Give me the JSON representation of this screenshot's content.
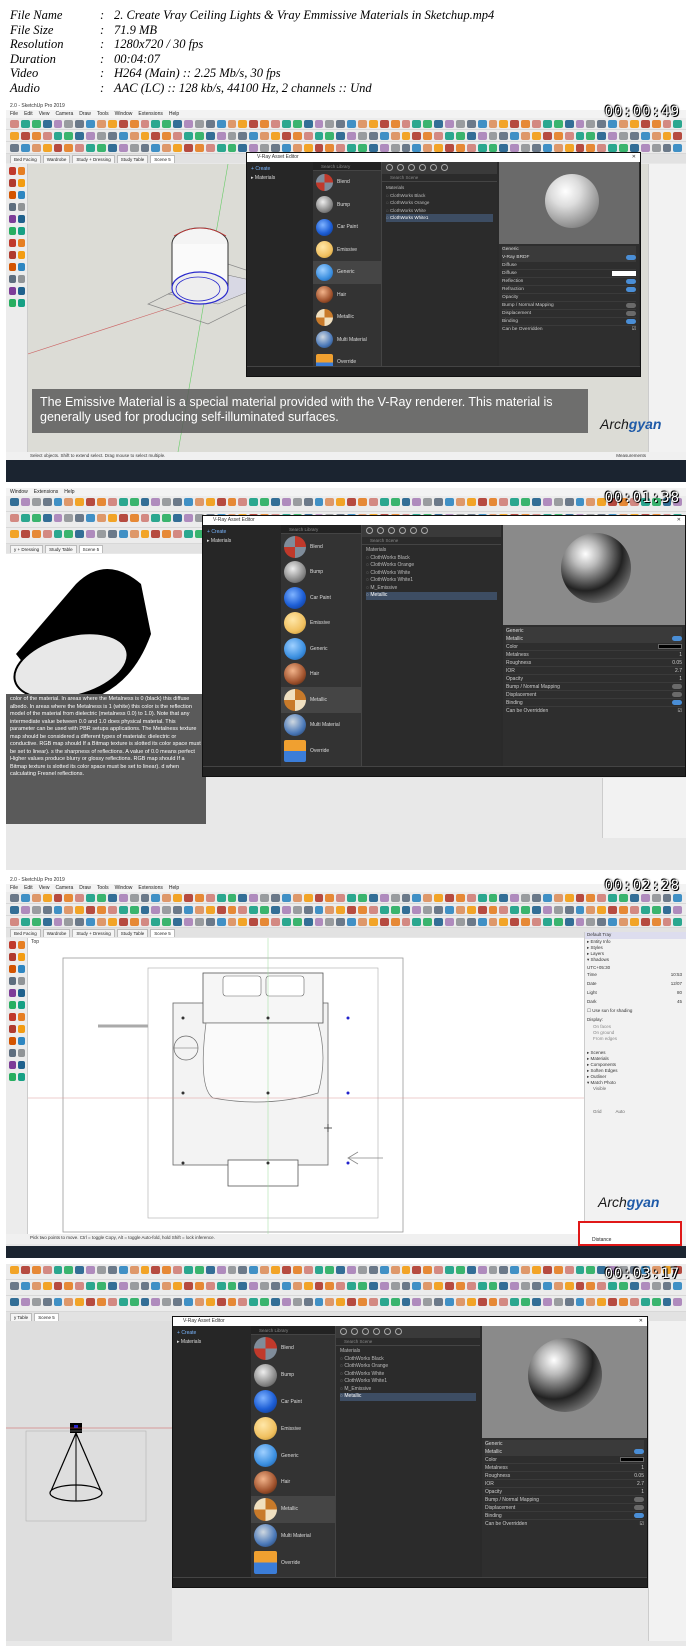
{
  "header": {
    "rows": [
      {
        "key": "File Name",
        "value": "2. Create Vray Ceiling Lights & Vray Emmissive Materials in Sketchup.mp4"
      },
      {
        "key": "File Size",
        "value": "71.9 MB"
      },
      {
        "key": "Resolution",
        "value": "1280x720 / 30 fps"
      },
      {
        "key": "Duration",
        "value": "00:04:07"
      },
      {
        "key": "Video",
        "value": "H264 (Main) :: 2.25 Mb/s, 30 fps"
      },
      {
        "key": "Audio",
        "value": "AAC (LC) :: 128 kb/s, 44100 Hz, 2 channels :: Und"
      }
    ]
  },
  "frames": [
    {
      "timestamp": "00:00:49"
    },
    {
      "timestamp": "00:01:38"
    },
    {
      "timestamp": "00:02:28"
    },
    {
      "timestamp": "00:03:17"
    }
  ],
  "app": {
    "title": "2.0 - SketchUp Pro 2019",
    "menu": [
      "File",
      "Edit",
      "View",
      "Camera",
      "Draw",
      "Tools",
      "Window",
      "Extensions",
      "Help"
    ],
    "scenes": [
      "Bed Facing",
      "Wardrobe",
      "Study + Dressing",
      "Study Table",
      "Scene 5"
    ],
    "status_frame1": "Select objects. Shift to extend select. Drag mouse to select multiple.",
    "status_frame3": "Pick two points to move.  Ctrl = toggle Copy, Alt = toggle Auto-fold, hold Shift = lock inference.",
    "measurements_label": "Measurements",
    "distance_label": "Distance",
    "top_label": "Top"
  },
  "editor": {
    "title": "V-Ray Asset Editor",
    "tree": [
      "Create",
      "Materials"
    ],
    "search_library": "Search Library",
    "search_scene": "Search Scene",
    "library": [
      "Blend",
      "Bump",
      "Car Paint",
      "Emissive",
      "Generic",
      "Hair",
      "Metallic",
      "Multi Material",
      "Override"
    ],
    "scene_header": "Materials",
    "scene_list_a": [
      "ClothWorks Black",
      "ClothWorks Orange",
      "ClothWorks White",
      "ClothWorks White1"
    ],
    "scene_list_b": [
      "ClothWorks Black",
      "ClothWorks Orange",
      "ClothWorks White",
      "ClothWorks White1",
      "M_Emissive",
      "Metallic"
    ],
    "props_a": {
      "generic": "Generic",
      "rows": [
        "V-Ray BRDF",
        "Diffuse",
        "Diffuse",
        "Reflection",
        "Refraction",
        "Opacity",
        "Bump / Normal Mapping",
        "Displacement",
        "Binding"
      ],
      "overridden": "Can be Overridden"
    },
    "props_b": {
      "generic": "Generic",
      "section": "Metallic",
      "rows": [
        {
          "label": "Color",
          "value": ""
        },
        {
          "label": "Metalness",
          "value": "1"
        },
        {
          "label": "Roughness",
          "value": "0.05"
        },
        {
          "label": "IOR",
          "value": "2.7"
        },
        {
          "label": "Opacity",
          "value": "1"
        }
      ],
      "sections": [
        "Bump / Normal Mapping",
        "Displacement",
        "Binding"
      ],
      "overridden": "Can be Overridden"
    }
  },
  "caption": "The Emissive Material is a special material provided with the V-Ray renderer. This material is generally used for producing self-illuminated surfaces.",
  "help_text": "color of the material. In areas where the Metalness is 0 (black) this diffuse albedo. In areas where the Metalness is 1 (white) this color is the reflection model of the material from dielectric (metalness 0.0) to 1.0). Note that any intermediate value between 0.0 and 1.0 does physical material. This parameter can be used with PBR setups applications. The Metalness texture map should be considered a different types of materials: dielectric or conductive. RGB map should If a Bitmap texture is slotted its color space must be set to linear). s the sharpness of reflections. A value of 0.0 means perfect Higher values produce blurry or glossy reflections. RGB map should If a Bitmap texture is slotted its color space must be set to linear). d when calculating Fresnel reflections.",
  "logo": {
    "a": "Arch",
    "b": "gyan"
  },
  "tray": {
    "panel_title": "Default Tray",
    "items": [
      "Entity Info",
      "Styles",
      "Layers",
      "Shadows",
      "Scenes",
      "Materials",
      "Components",
      "Soften Edges",
      "Outliner",
      "Match Photo"
    ],
    "time_label": "Time",
    "date_label": "Date",
    "light_label": "Light",
    "dark_label": "Dark",
    "utc": "UTC+05:30",
    "time_val": "10:53",
    "date_val": "12/07",
    "light_val": "80",
    "dark_val": "45",
    "sun_shading": "Use sun for shading",
    "display": "Display:",
    "on_faces": "On faces",
    "on_ground": "On ground",
    "from_edges": "From edges",
    "visible": "Visible",
    "grid": "Grid",
    "auto": "Auto"
  }
}
